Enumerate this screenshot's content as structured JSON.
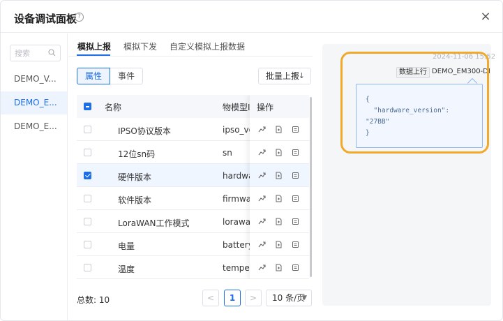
{
  "dialog": {
    "title": "设备调试面板",
    "close": "×",
    "help": "?"
  },
  "sidebar": {
    "search_placeholder": "搜索",
    "devices": [
      {
        "label": "DEMO_V..."
      },
      {
        "label": "DEMO_E..."
      },
      {
        "label": "DEMO_E..."
      }
    ]
  },
  "tabs": [
    "模拟上报",
    "模拟下发",
    "自定义模拟上报数据"
  ],
  "toggle": {
    "properties": "属性",
    "events": "事件"
  },
  "batch_report": {
    "label": "批量上报",
    "icon": "↑↓"
  },
  "table": {
    "headers": {
      "name": "名称",
      "model_id": "物模型ID",
      "ops": "操作"
    },
    "rows": [
      {
        "name": "IPSO协议版本",
        "id": "ipso_version",
        "checked": false
      },
      {
        "name": "12位sn码",
        "id": "sn",
        "checked": false
      },
      {
        "name": "硬件版本",
        "id": "hardware_version",
        "checked": true
      },
      {
        "name": "软件版本",
        "id": "firmware_version",
        "checked": false
      },
      {
        "name": "LoraWAN工作模式",
        "id": "lorawan_class",
        "checked": false
      },
      {
        "name": "电量",
        "id": "battery",
        "checked": false
      },
      {
        "name": "温度",
        "id": "temperature",
        "checked": false
      }
    ]
  },
  "pagination": {
    "total_label": "总数:",
    "total": "10",
    "prev": "<",
    "current": "1",
    "next": ">",
    "page_size": "10 条/页"
  },
  "log": {
    "timestamp": "2024-11-06 15:52",
    "tag": "数据上行",
    "device": "DEMO_EM300-DI",
    "json_lines": [
      "{",
      "  \"hardware_version\":",
      "\"27BB\"",
      "}"
    ]
  },
  "colors": {
    "accent": "#1d6fe8",
    "highlight": "#f0a92a"
  }
}
